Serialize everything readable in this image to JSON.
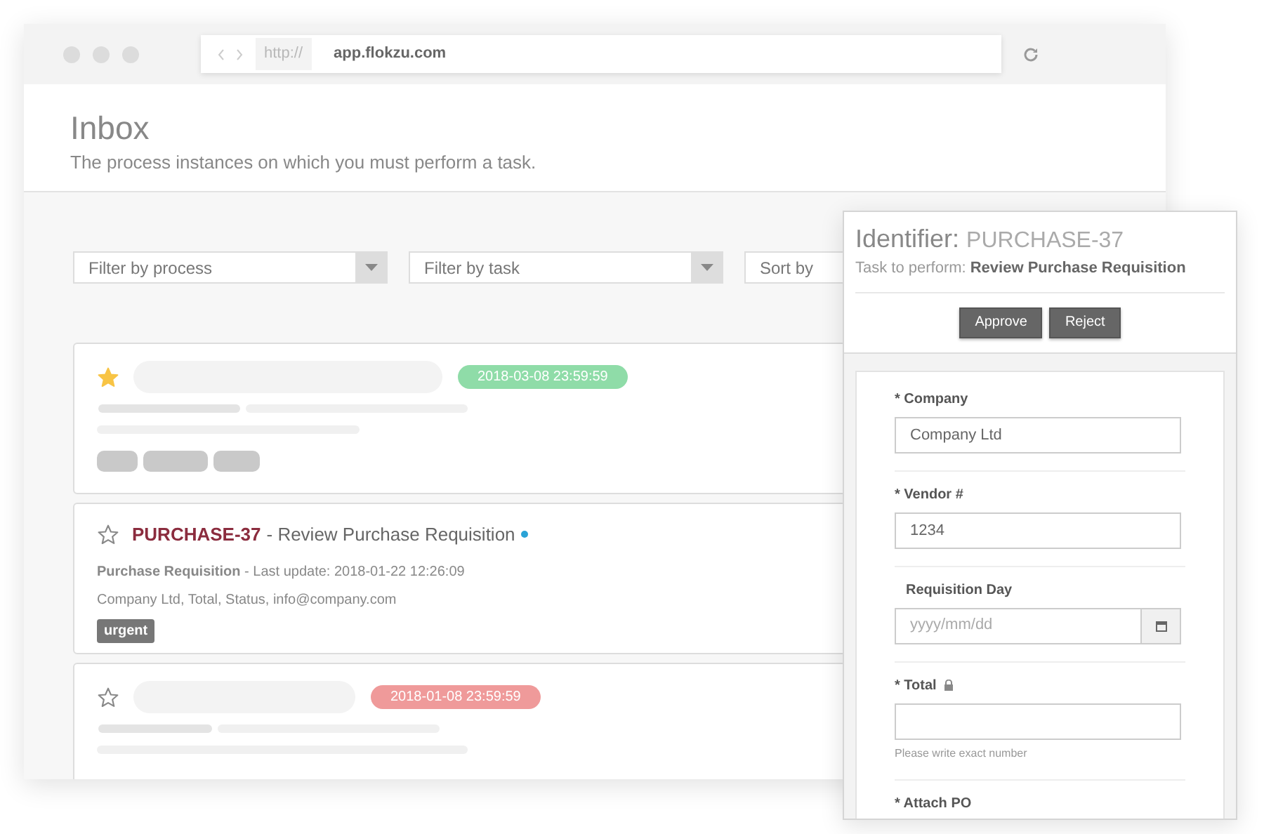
{
  "browser": {
    "url_scheme": "http://",
    "url": "app.flokzu.com"
  },
  "header": {
    "title": "Inbox",
    "subtitle": "The process instances on which you must perform a task."
  },
  "filters": [
    {
      "placeholder": "Filter by process"
    },
    {
      "placeholder": "Filter by task"
    }
  ],
  "sort": {
    "label": "Sort by"
  },
  "cards": [
    {
      "kind": "skeleton",
      "starred": true,
      "due": "2018-03-08 23:59:59",
      "color": "#8fdca8"
    },
    {
      "kind": "task",
      "starred": false,
      "identifier": "PURCHASE-37",
      "title": "- Review Purchase Requisition",
      "unread": true,
      "meta": "**Purchase Requisition** - Last update: 2018-01-22 12:26:09",
      "summary": "Company Ltd, Total, Status, info@company.com",
      "tags": [
        "urgent"
      ]
    },
    {
      "kind": "skeleton",
      "starred": false,
      "due": "2018-01-08 23:59:59",
      "color": "#ef9a9a"
    }
  ],
  "panel": {
    "identifier_label": "Identifier:",
    "identifier": "PURCHASE-37",
    "task_label": "Task to perform:",
    "task": "Review Purchase Requisition",
    "buttons": [
      "Approve",
      "Reject"
    ],
    "fields": [
      {
        "kind": "text",
        "label": "* Company",
        "value": "Company Ltd"
      },
      {
        "kind": "text",
        "label": "* Vendor #",
        "value": "1234"
      },
      {
        "kind": "date",
        "label": "Requisition Day",
        "placeholder": "yyyy/mm/dd"
      },
      {
        "kind": "text",
        "label": "* Total",
        "locked": true,
        "help": "Please write exact number"
      },
      {
        "kind": "file",
        "label": "* Attach PO"
      }
    ]
  }
}
